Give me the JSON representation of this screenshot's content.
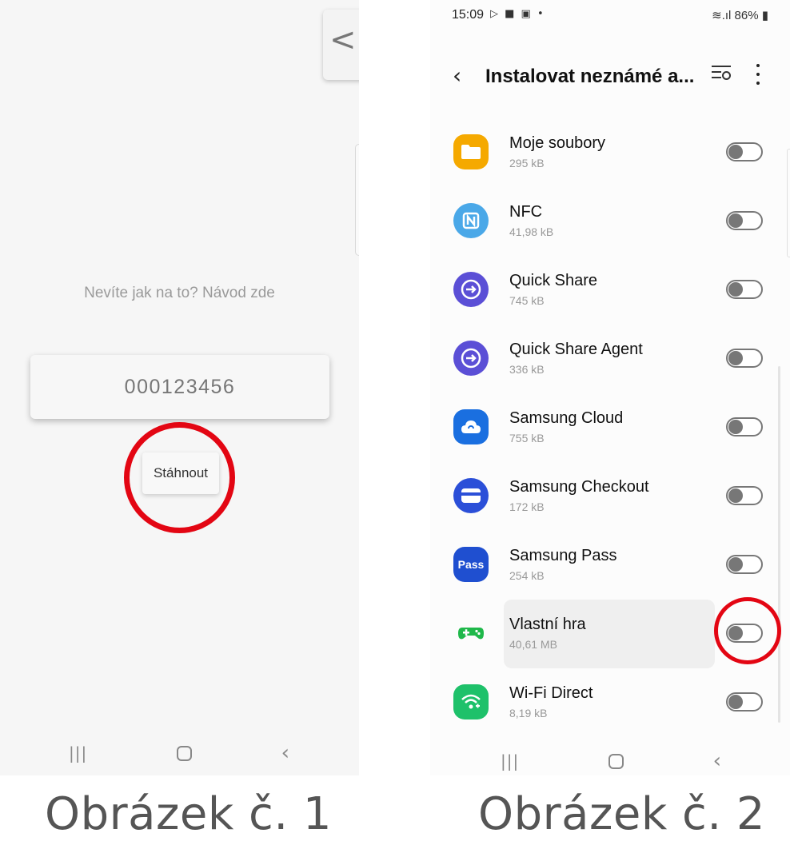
{
  "screen1": {
    "back_tab_glyph": "<",
    "hint_text": "Nevíte jak na to? Návod zde",
    "code_value": "000123456",
    "download_label": "Stáhnout",
    "nav": {
      "recent": "|||",
      "back": "‹"
    },
    "caption": "Obrázek č. 1"
  },
  "screen2": {
    "status": {
      "time": "15:09",
      "notifications": "▷ ■ ▣ •",
      "right": "≋.ıl 86% ▮"
    },
    "header": {
      "back": "‹",
      "title": "Instalovat neznámé a...",
      "icons": [
        "search-list-icon",
        "more-options-icon"
      ]
    },
    "apps": [
      {
        "name": "Moje soubory",
        "size": "295 kB",
        "icon": "folder-icon",
        "icon_color": "#f5a900",
        "enabled": false
      },
      {
        "name": "NFC",
        "size": "41,98 kB",
        "icon": "nfc-icon",
        "icon_color": "#4aa8e8",
        "enabled": false
      },
      {
        "name": "Quick Share",
        "size": "745 kB",
        "icon": "quick-share-icon",
        "icon_color": "#5b4fd6",
        "enabled": false
      },
      {
        "name": "Quick Share Agent",
        "size": "336 kB",
        "icon": "quick-share-agent-icon",
        "icon_color": "#5b4fd6",
        "enabled": false
      },
      {
        "name": "Samsung Cloud",
        "size": "755 kB",
        "icon": "cloud-icon",
        "icon_color": "#1a6fe0",
        "enabled": false
      },
      {
        "name": "Samsung Checkout",
        "size": "172 kB",
        "icon": "checkout-icon",
        "icon_color": "#2b4fd8",
        "enabled": false
      },
      {
        "name": "Samsung Pass",
        "size": "254 kB",
        "icon": "pass-icon",
        "icon_color": "#1f4fd0",
        "icon_text": "Pass",
        "enabled": false
      },
      {
        "name": "Vlastní hra",
        "size": "40,61 MB",
        "icon": "gamepad-icon",
        "icon_color": "#1fb84a",
        "enabled": false
      },
      {
        "name": "Wi-Fi Direct",
        "size": "8,19 kB",
        "icon": "wifi-direct-icon",
        "icon_color": "#1ec16a",
        "enabled": false
      }
    ],
    "nav": {
      "recent": "|||",
      "back": "‹"
    },
    "caption": "Obrázek č. 2"
  },
  "colors": {
    "highlight_ring": "#e30613",
    "toggle_off": "#777777"
  }
}
